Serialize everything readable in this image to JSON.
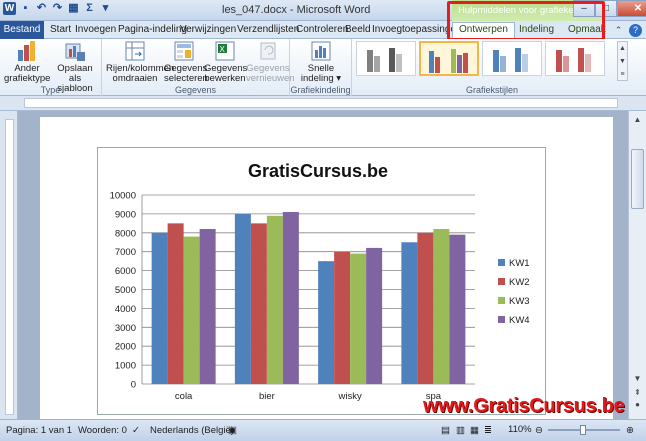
{
  "window": {
    "title": "les_047.docx - Microsoft Word",
    "context_group": "Hulpmiddelen voor grafieken"
  },
  "tabs": {
    "file": "Bestand",
    "start": "Start",
    "insert": "Invoegen",
    "page_layout": "Pagina-indeling",
    "references": "Verwijzingen",
    "mailings": "Verzendlijsten",
    "review": "Controleren",
    "view": "Beeld",
    "addins": "Invoegtoepassingen",
    "design": "Ontwerpen",
    "layout": "Indeling",
    "format": "Opmaak"
  },
  "ribbon": {
    "type_group": "Type",
    "change_type": [
      "Ander",
      "grafiektype"
    ],
    "save_template": [
      "Opslaan als",
      "sjabloon"
    ],
    "data_group": "Gegevens",
    "switch_row": [
      "Rijen/kolommen",
      "omdraaien"
    ],
    "select_data": [
      "Gegevens",
      "selecteren"
    ],
    "edit_data": [
      "Gegevens",
      "bewerken"
    ],
    "refresh_data": [
      "Gegevens",
      "vernieuwen"
    ],
    "layouts_group": "Grafiekindeling",
    "quick_layout": [
      "Snelle",
      "indeling ▾"
    ],
    "styles_group": "Grafiekstijlen"
  },
  "status": {
    "page": "Pagina: 1 van 1",
    "words": "Woorden: 0",
    "language": "Nederlands (België)",
    "zoom": "110%"
  },
  "watermark": "www.GratisCursus.be",
  "chart_data": {
    "type": "bar",
    "title": "GratisCursus.be",
    "categories": [
      "cola",
      "bier",
      "wisky",
      "spa"
    ],
    "series": [
      {
        "name": "KW1",
        "color": "#4f81bd",
        "values": [
          8000,
          9000,
          6500,
          7500
        ]
      },
      {
        "name": "KW2",
        "color": "#c0504d",
        "values": [
          8500,
          8500,
          7000,
          8000
        ]
      },
      {
        "name": "KW3",
        "color": "#9bbb59",
        "values": [
          7800,
          8900,
          6900,
          8200
        ]
      },
      {
        "name": "KW4",
        "color": "#8064a2",
        "values": [
          8200,
          9100,
          7200,
          7900
        ]
      }
    ],
    "yticks": [
      "0",
      "1000",
      "2000",
      "3000",
      "4000",
      "5000",
      "6000",
      "7000",
      "8000",
      "9000",
      "10000"
    ],
    "ylim": [
      0,
      10000
    ],
    "grid": true,
    "legend": "right"
  }
}
